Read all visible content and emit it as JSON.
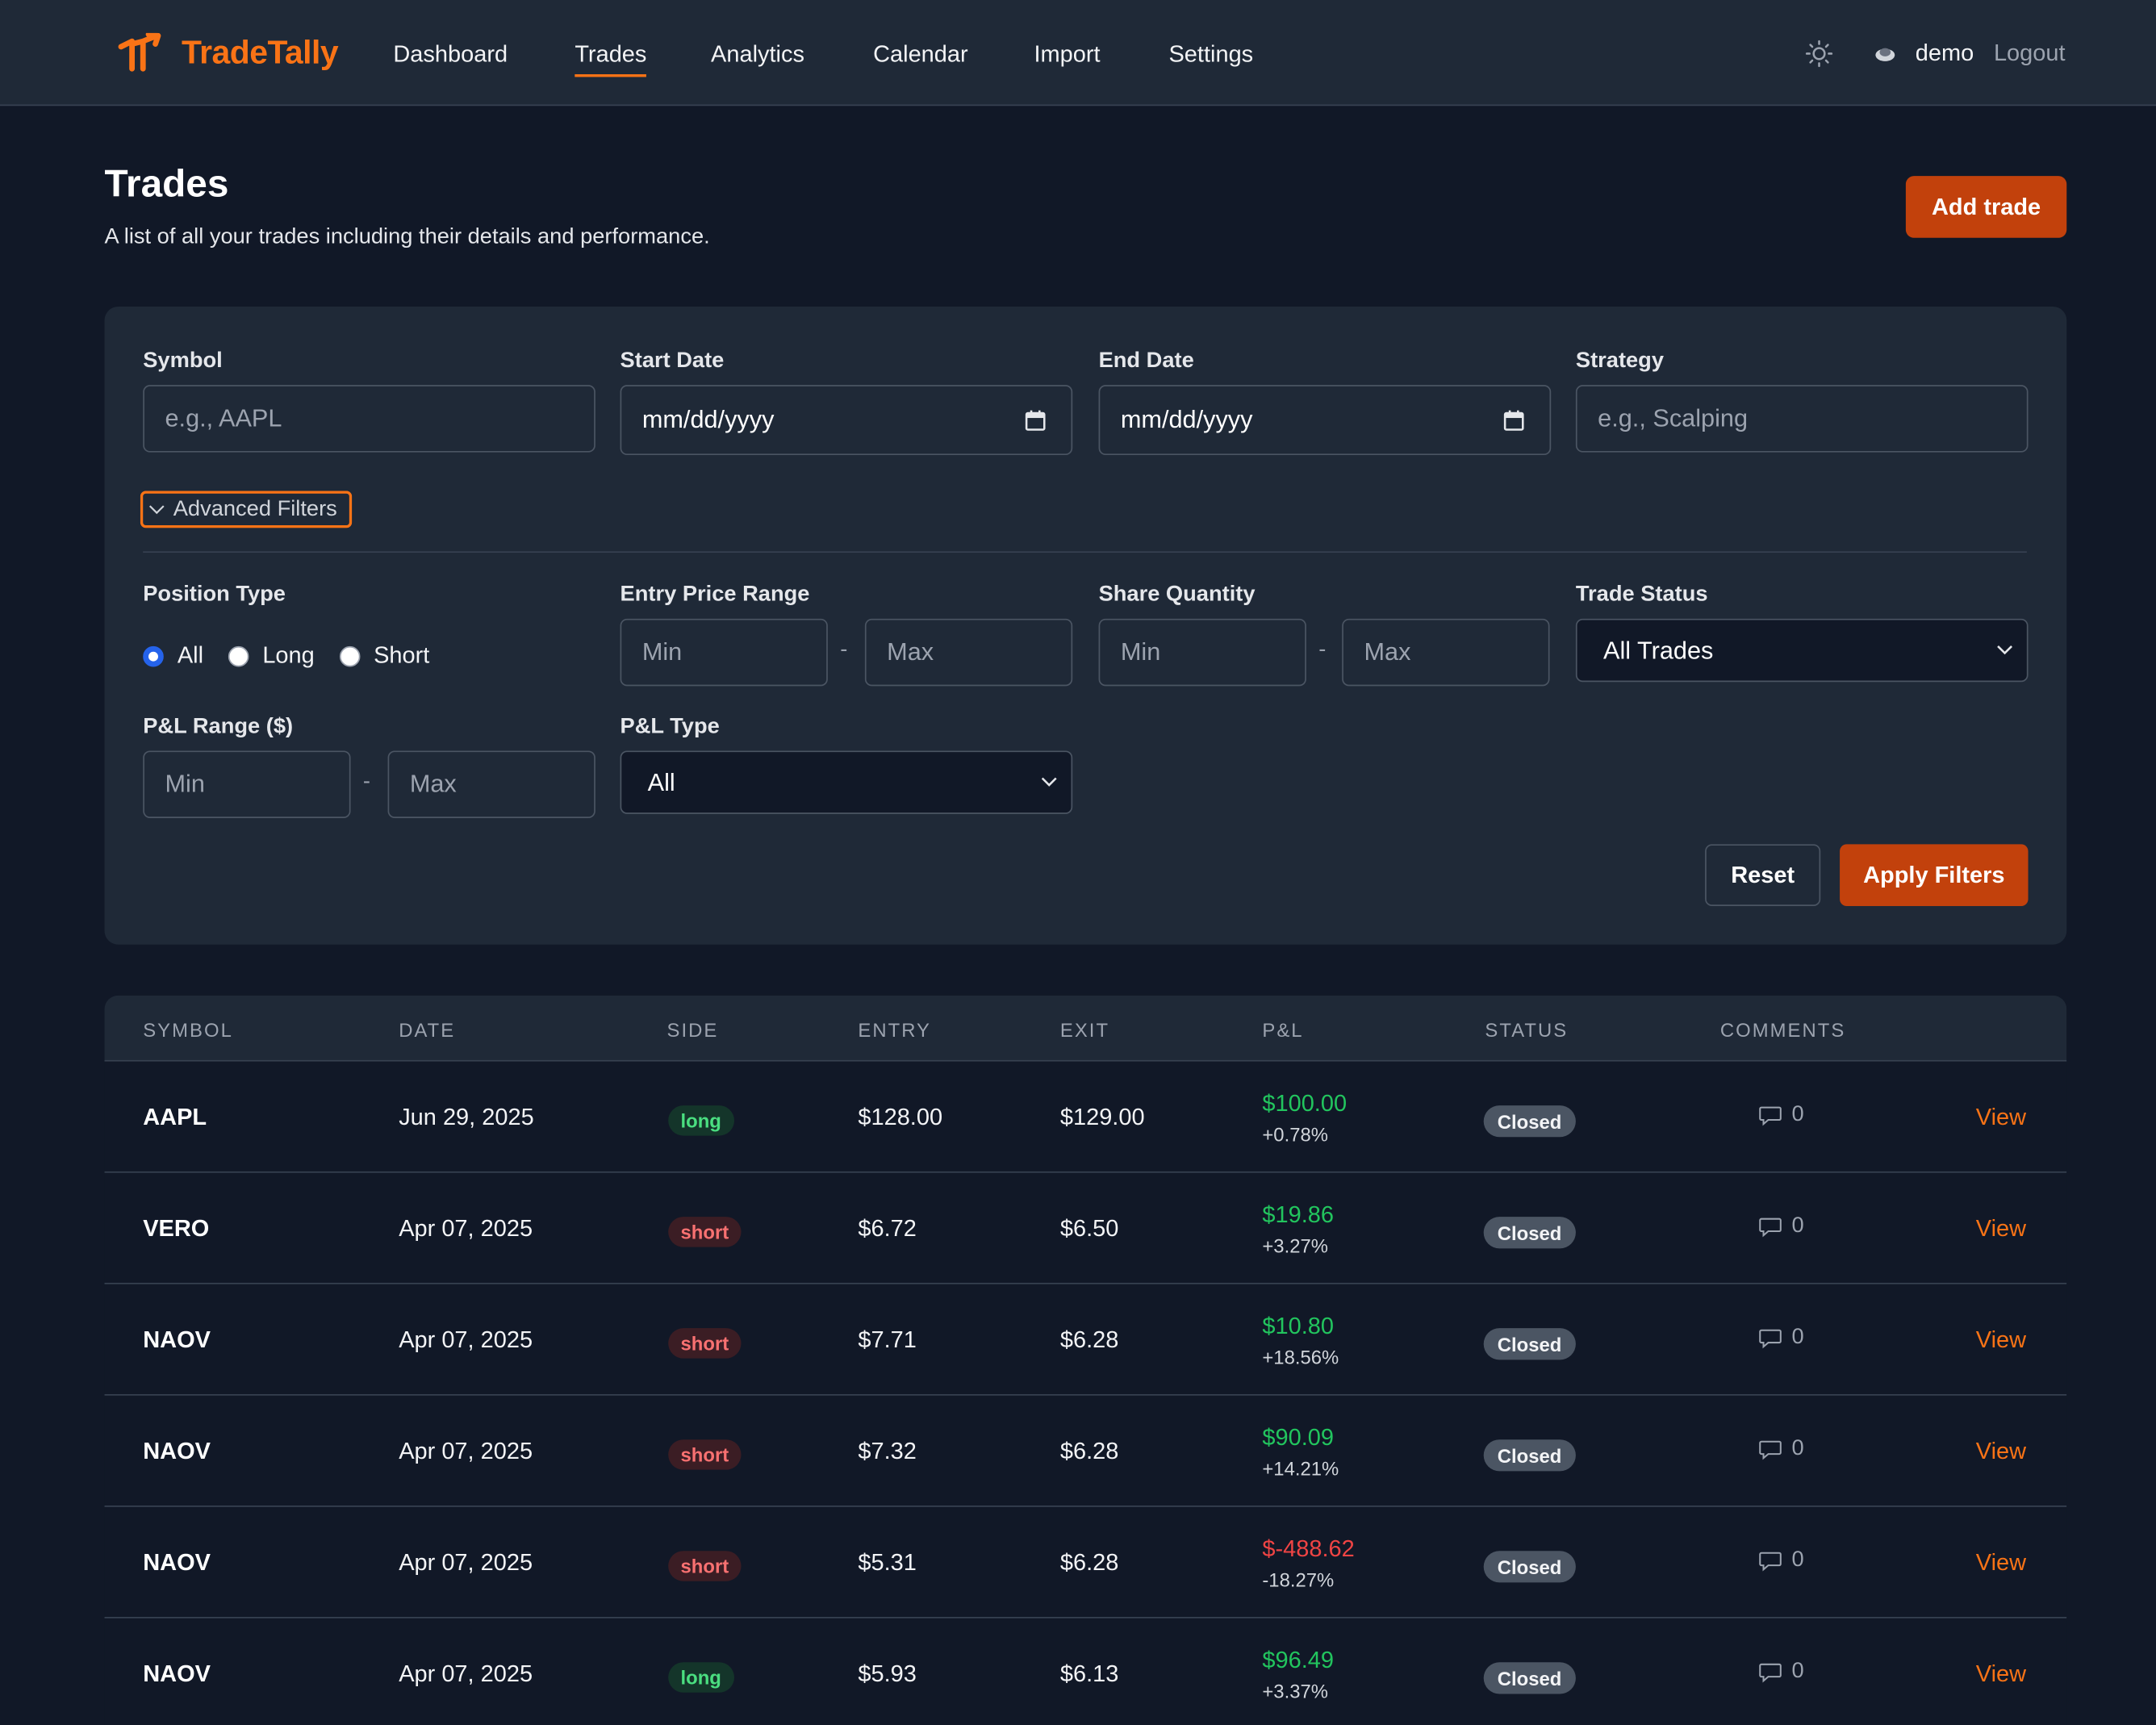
{
  "app": {
    "name": "TradeTally"
  },
  "nav": {
    "links": [
      {
        "label": "Dashboard"
      },
      {
        "label": "Trades"
      },
      {
        "label": "Analytics"
      },
      {
        "label": "Calendar"
      },
      {
        "label": "Import"
      },
      {
        "label": "Settings"
      }
    ],
    "active": "Trades",
    "username": "demo",
    "logout_label": "Logout"
  },
  "header": {
    "title": "Trades",
    "subtitle": "A list of all your trades including their details and performance.",
    "add_label": "Add trade"
  },
  "filters": {
    "symbol": {
      "label": "Symbol",
      "placeholder": "e.g., AAPL"
    },
    "start_date": {
      "label": "Start Date",
      "value": "mm/dd/yyyy"
    },
    "end_date": {
      "label": "End Date",
      "value": "mm/dd/yyyy"
    },
    "strategy": {
      "label": "Strategy",
      "placeholder": "e.g., Scalping"
    },
    "advanced_label": "Advanced Filters",
    "position_type": {
      "label": "Position Type",
      "options": [
        "All",
        "Long",
        "Short"
      ],
      "selected": "All"
    },
    "entry_price": {
      "label": "Entry Price Range",
      "min_placeholder": "Min",
      "max_placeholder": "Max",
      "separator": "-"
    },
    "share_quantity": {
      "label": "Share Quantity",
      "min_placeholder": "Min",
      "max_placeholder": "Max",
      "separator": "-"
    },
    "trade_status": {
      "label": "Trade Status",
      "value": "All Trades"
    },
    "pnl_range": {
      "label": "P&L Range ($)",
      "min_placeholder": "Min",
      "max_placeholder": "Max",
      "separator": "-"
    },
    "pnl_type": {
      "label": "P&L Type",
      "value": "All"
    },
    "reset_label": "Reset",
    "apply_label": "Apply Filters"
  },
  "table": {
    "columns": [
      "SYMBOL",
      "DATE",
      "SIDE",
      "ENTRY",
      "EXIT",
      "P&L",
      "STATUS",
      "COMMENTS"
    ],
    "view_label": "View",
    "rows": [
      {
        "symbol": "AAPL",
        "date": "Jun 29, 2025",
        "side": "long",
        "entry": "$128.00",
        "exit": "$129.00",
        "pnl": "$100.00",
        "pct": "+0.78%",
        "status": "Closed",
        "comments": "0"
      },
      {
        "symbol": "VERO",
        "date": "Apr 07, 2025",
        "side": "short",
        "entry": "$6.72",
        "exit": "$6.50",
        "pnl": "$19.86",
        "pct": "+3.27%",
        "status": "Closed",
        "comments": "0"
      },
      {
        "symbol": "NAOV",
        "date": "Apr 07, 2025",
        "side": "short",
        "entry": "$7.71",
        "exit": "$6.28",
        "pnl": "$10.80",
        "pct": "+18.56%",
        "status": "Closed",
        "comments": "0"
      },
      {
        "symbol": "NAOV",
        "date": "Apr 07, 2025",
        "side": "short",
        "entry": "$7.32",
        "exit": "$6.28",
        "pnl": "$90.09",
        "pct": "+14.21%",
        "status": "Closed",
        "comments": "0"
      },
      {
        "symbol": "NAOV",
        "date": "Apr 07, 2025",
        "side": "short",
        "entry": "$5.31",
        "exit": "$6.28",
        "pnl": "$-488.62",
        "pct": "-18.27%",
        "status": "Closed",
        "comments": "0"
      },
      {
        "symbol": "NAOV",
        "date": "Apr 07, 2025",
        "side": "long",
        "entry": "$5.93",
        "exit": "$6.13",
        "pnl": "$96.49",
        "pct": "+3.37%",
        "status": "Closed",
        "comments": "0"
      }
    ]
  },
  "colors": {
    "accent": "#f97316",
    "button": "#c2410c",
    "background": "#111827",
    "surface": "#1f2937",
    "positive": "#22c55e",
    "negative": "#ef4444"
  },
  "icons": [
    "tradetally-logo",
    "sun-icon",
    "avatar-icon",
    "calendar-icon",
    "chevron-down-icon",
    "comment-icon"
  ]
}
